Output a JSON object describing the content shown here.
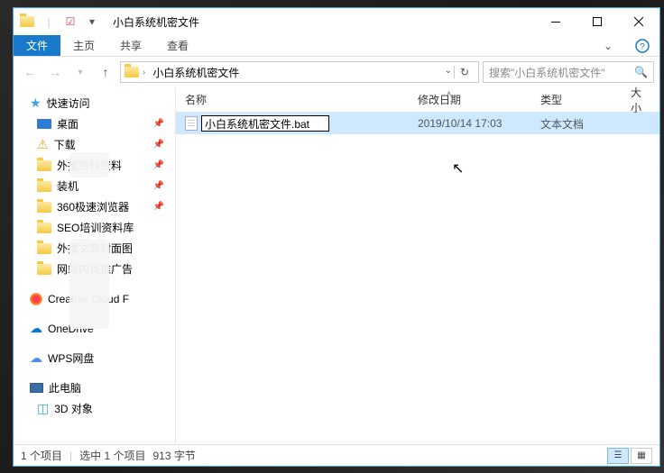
{
  "title": "小白系统机密文件",
  "tabs": {
    "file": "文件",
    "home": "主页",
    "share": "共享",
    "view": "查看"
  },
  "path": {
    "crumb": "小白系统机密文件"
  },
  "search": {
    "placeholder": "搜索\"小白系统机密文件\""
  },
  "sidebar": {
    "quick": "快速访问",
    "items": [
      {
        "label": "桌面",
        "pinned": true
      },
      {
        "label": "下载",
        "pinned": true
      },
      {
        "label": "外推资料资料",
        "pinned": true
      },
      {
        "label": "装机",
        "pinned": true
      },
      {
        "label": "360极速浏览器",
        "pinned": true
      },
      {
        "label": "SEO培训资料库"
      },
      {
        "label": "外推文章封面图"
      },
      {
        "label": "网站内页推广告"
      }
    ],
    "cc": "Creative Cloud F",
    "onedrive": "OneDrive",
    "wps": "WPS网盘",
    "thispc": "此电脑",
    "obj3d": "3D 对象"
  },
  "columns": {
    "name": "名称",
    "date": "修改日期",
    "type": "类型",
    "size": "大小"
  },
  "file": {
    "rename_value": "小白系统机密文件.bat",
    "date": "2019/10/14 17:03",
    "type": "文本文档"
  },
  "status": {
    "count": "1 个项目",
    "selected": "选中 1 个项目",
    "bytes": "913 字节"
  }
}
